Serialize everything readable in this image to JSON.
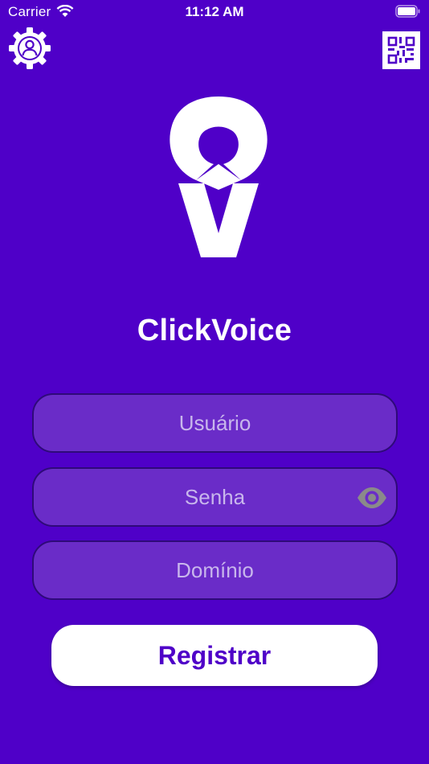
{
  "status_bar": {
    "carrier": "Carrier",
    "time": "11:12 AM"
  },
  "header": {
    "settings_icon": "user-gear-icon",
    "qr_icon": "qr-code-icon"
  },
  "app": {
    "title": "ClickVoice"
  },
  "form": {
    "username_placeholder": "Usuário",
    "password_placeholder": "Senha",
    "domain_placeholder": "Domínio",
    "register_label": "Registrar"
  },
  "colors": {
    "background": "#4f00c8",
    "field_fill": "#6a2cc8",
    "field_border": "#2f0a7a",
    "button_text": "#4f00c8",
    "eye_icon": "#8a8a8a"
  }
}
